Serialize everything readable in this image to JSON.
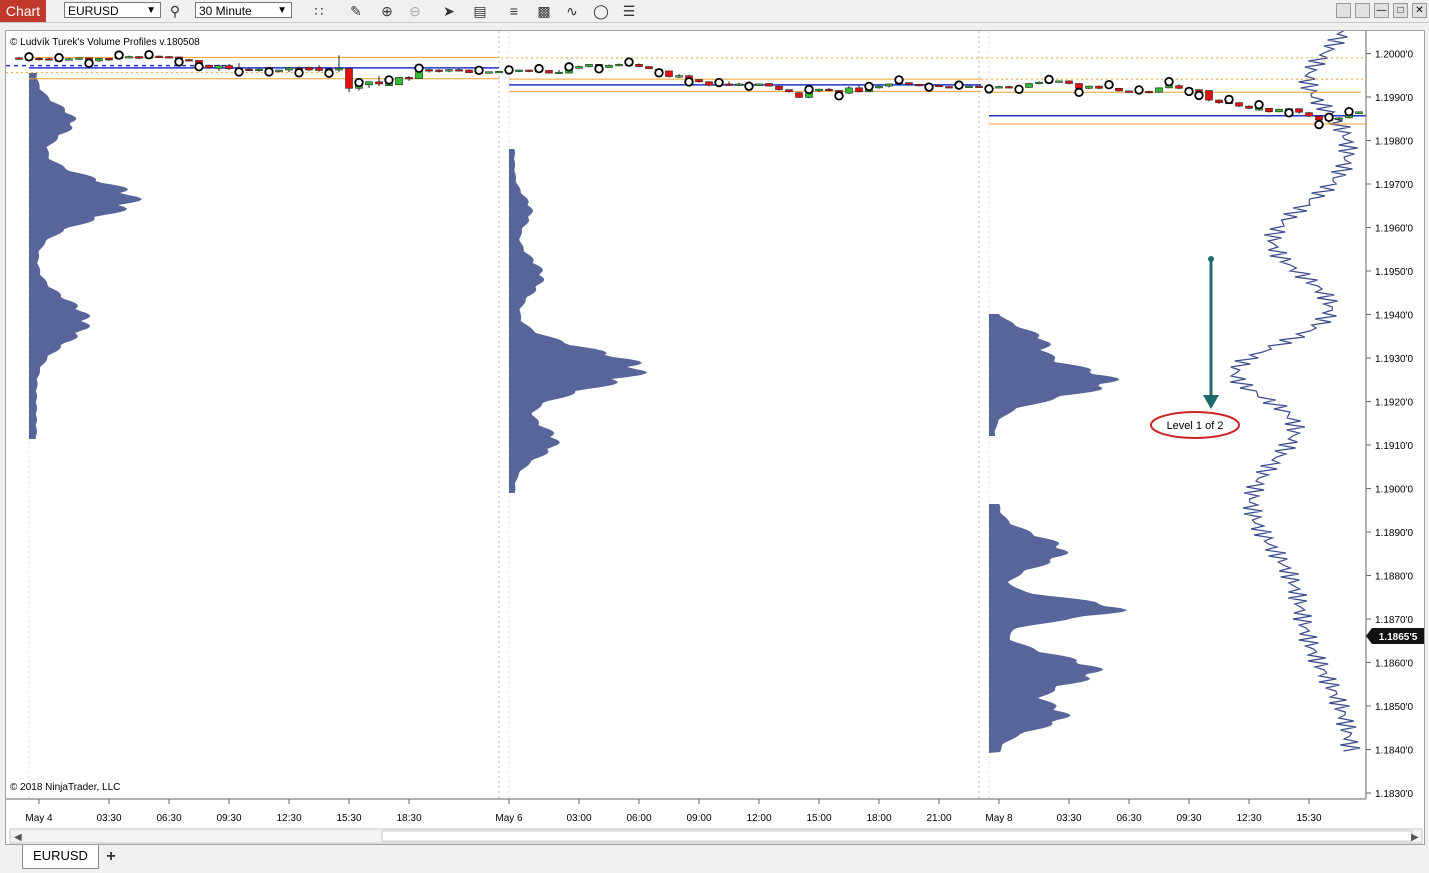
{
  "toolbar": {
    "chart_label": "Chart",
    "instrument": "EURUSD",
    "interval": "30 Minute",
    "icons": [
      "search-icon",
      "bar-type-icon",
      "draw-pencil-icon",
      "zoom-in-icon",
      "zoom-out-icon",
      "pointer-icon",
      "data-box-icon",
      "strategies-icon",
      "indicators-icon",
      "drawing-tools-icon",
      "refresh-icon",
      "properties-icon"
    ]
  },
  "chart": {
    "copyright_top": "© Ludvík Turek's Volume Profiles v.180508",
    "copyright_bottom": "© 2018 NinjaTrader, LLC",
    "current_price": "1.1865'5",
    "annotation": "Level 1 of 2",
    "price_ticks": [
      "1.2000'0",
      "1.1990'0",
      "1.1980'0",
      "1.1970'0",
      "1.1960'0",
      "1.1950'0",
      "1.1940'0",
      "1.1930'0",
      "1.1920'0",
      "1.1910'0",
      "1.1900'0",
      "1.1890'0",
      "1.1880'0",
      "1.1870'0",
      "1.1860'0",
      "1.1850'0",
      "1.1840'0",
      "1.1830'0"
    ],
    "time_ticks": [
      "May 4",
      "03:30",
      "06:30",
      "09:30",
      "12:30",
      "15:30",
      "18:30",
      "May 6",
      "03:00",
      "06:00",
      "09:00",
      "12:00",
      "15:00",
      "18:00",
      "21:00",
      "May 8",
      "03:30",
      "06:30",
      "09:30",
      "12:30",
      "15:30"
    ],
    "colors": {
      "up": "#33bb33",
      "down": "#e01010",
      "poc": "#2233cc",
      "level": "#f0a030",
      "profile": "#3a4a8a",
      "profile_alt": "#2e5b40",
      "arrow": "#1f6b6b"
    }
  },
  "tabs": {
    "active": "EURUSD",
    "add_label": "+"
  }
}
